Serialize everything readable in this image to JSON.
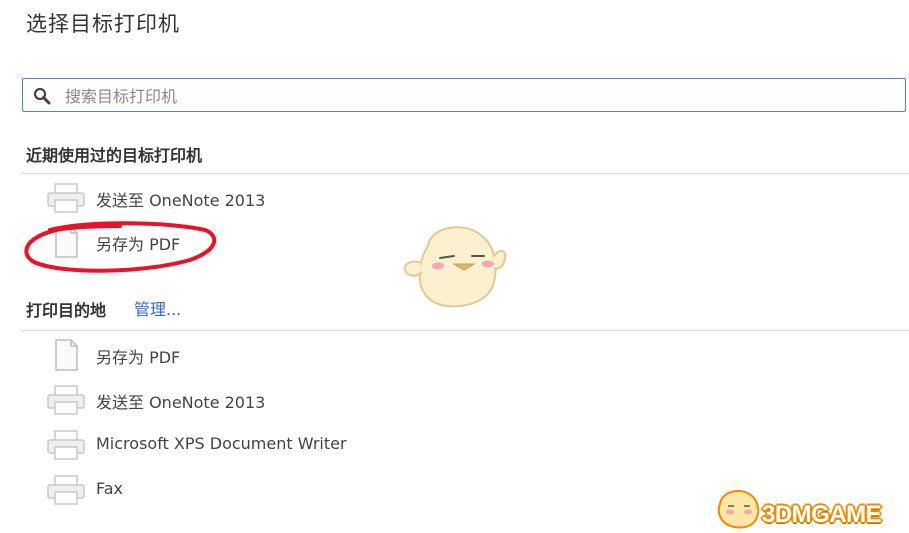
{
  "dialog": {
    "title": "选择目标打印机",
    "search": {
      "placeholder": "搜索目标打印机",
      "value": ""
    }
  },
  "recent": {
    "heading": "近期使用过的目标打印机",
    "items": [
      {
        "label": "发送至 OneNote 2013",
        "icon": "printer-icon"
      },
      {
        "label": "另存为 PDF",
        "icon": "document-icon"
      }
    ]
  },
  "destinations": {
    "heading": "打印目的地",
    "manage_label": "管理...",
    "items": [
      {
        "label": "另存为 PDF",
        "icon": "document-icon"
      },
      {
        "label": "发送至 OneNote 2013",
        "icon": "printer-icon"
      },
      {
        "label": "Microsoft XPS Document Writer",
        "icon": "printer-icon"
      },
      {
        "label": "Fax",
        "icon": "printer-icon"
      }
    ]
  },
  "watermark": {
    "text": "3DMGAME"
  },
  "colors": {
    "accent": "#4a86d8",
    "link": "#3367d6",
    "annotation": "#e8122a",
    "watermark": "#f08a00"
  }
}
